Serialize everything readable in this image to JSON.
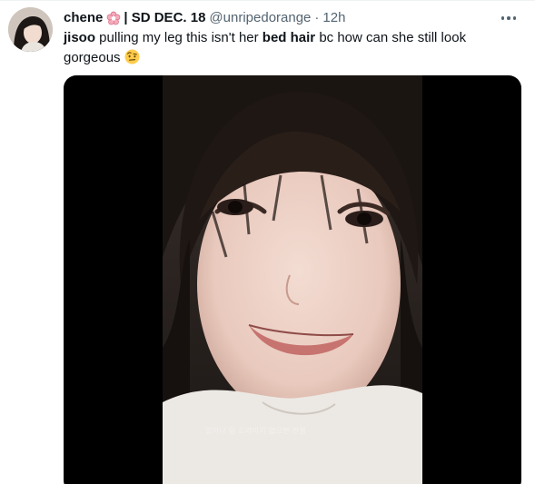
{
  "tweet": {
    "author_name": "chene",
    "author_name_suffix": "| SD DEC. 18",
    "handle": "@unripedorange",
    "separator": "·",
    "time": "12h",
    "text_parts": {
      "p1": "jisoo",
      "p2": " pulling my leg this isn't her ",
      "p3": "bed hair",
      "p4": " bc how can she still look gorgeous"
    },
    "icons": {
      "name_badge": "pink-flower-icon",
      "emoji": "face-with-raised-eyebrow-emoji",
      "more": "more-options-icon"
    }
  },
  "media": {
    "overlay_caption": "일어나 텀 드라이기 없으면 컨셉",
    "background_color": "#000000"
  },
  "colors": {
    "text_primary": "#0f1419",
    "text_secondary": "#536471",
    "badge_pink": "#f4abba"
  }
}
